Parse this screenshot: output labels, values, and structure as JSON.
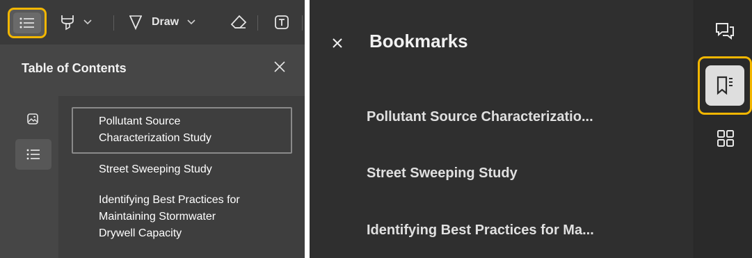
{
  "left_panel": {
    "toolbar": {
      "draw_label": "Draw"
    },
    "toc": {
      "title": "Table of Contents",
      "items": [
        {
          "label_line1": "Pollutant Source",
          "label_line2": "Characterization Study"
        },
        {
          "label": "Street Sweeping Study"
        },
        {
          "label_line1": "Identifying Best Practices for",
          "label_line2": "Maintaining Stormwater",
          "label_line3": "Drywell Capacity"
        }
      ]
    }
  },
  "right_panel": {
    "bookmarks": {
      "title": "Bookmarks",
      "items": [
        {
          "label": "Pollutant Source Characterizatio..."
        },
        {
          "label": "Street Sweeping Study"
        },
        {
          "label": "Identifying Best Practices for Ma..."
        }
      ]
    }
  },
  "colors": {
    "highlight_outline": "#f2b600",
    "left_background": "#464646",
    "right_background": "#2f2f2f"
  },
  "icons": {
    "toc_toggle": "list-icon",
    "highlight": "highlighter-icon",
    "draw": "pen-icon",
    "eraser": "eraser-icon",
    "text": "text-box-icon",
    "close": "close-icon",
    "thumbnails": "image-icon",
    "comments": "comments-icon",
    "bookmarks": "bookmark-icon",
    "grid": "grid-icon"
  }
}
